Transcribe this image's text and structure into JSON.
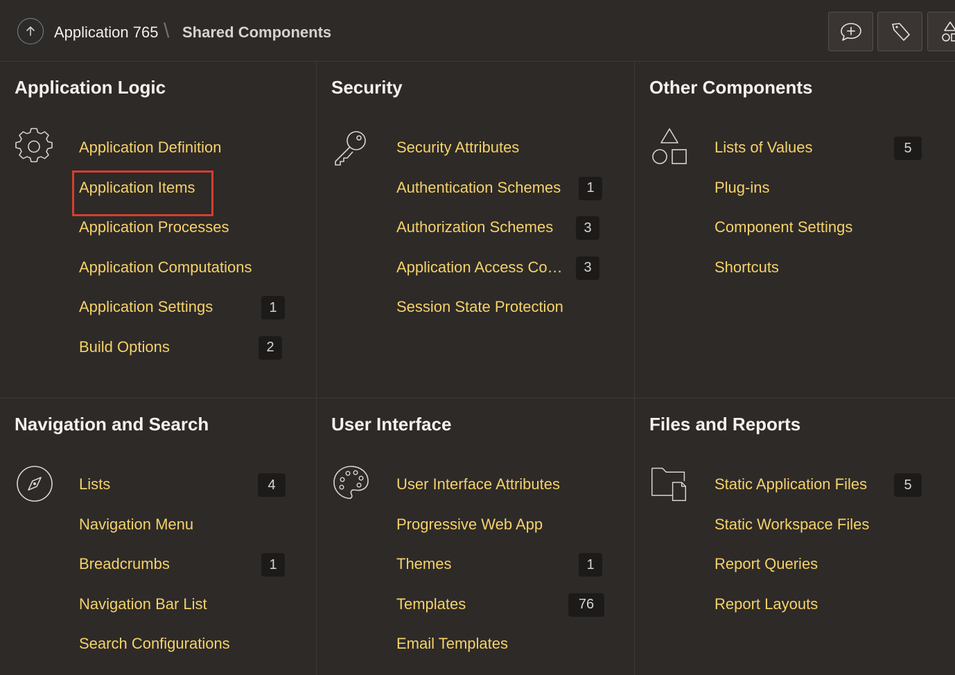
{
  "header": {
    "app_name": "Application 765",
    "separator": "\\",
    "current_page": "Shared Components",
    "tools": [
      "feedback-icon",
      "developer-toolbar-icon",
      "shapes-icon"
    ]
  },
  "accent_colors": {
    "link": "#f4d26a",
    "highlight": "#d2402e",
    "background": "#2e2a28"
  },
  "panels": [
    {
      "title": "Application Logic",
      "icon": "gear-icon",
      "items": [
        {
          "label": "Application Definition",
          "count": null
        },
        {
          "label": "Application Items",
          "count": null,
          "highlighted": true
        },
        {
          "label": "Application Processes",
          "count": null
        },
        {
          "label": "Application Computations",
          "count": null
        },
        {
          "label": "Application Settings",
          "count": "1"
        },
        {
          "label": "Build Options",
          "count": "2"
        }
      ]
    },
    {
      "title": "Security",
      "icon": "key-icon",
      "items": [
        {
          "label": "Security Attributes",
          "count": null
        },
        {
          "label": "Authentication Schemes",
          "count": "1"
        },
        {
          "label": "Authorization Schemes",
          "count": "3"
        },
        {
          "label": "Application Access Co…",
          "count": "3"
        },
        {
          "label": "Session State Protection",
          "count": null
        }
      ]
    },
    {
      "title": "Other Components",
      "icon": "shapes-icon",
      "items": [
        {
          "label": "Lists of Values",
          "count": "5"
        },
        {
          "label": "Plug-ins",
          "count": null
        },
        {
          "label": "Component Settings",
          "count": null
        },
        {
          "label": "Shortcuts",
          "count": null
        }
      ]
    },
    {
      "title": "Navigation and Search",
      "icon": "compass-icon",
      "items": [
        {
          "label": "Lists",
          "count": "4"
        },
        {
          "label": "Navigation Menu",
          "count": null
        },
        {
          "label": "Breadcrumbs",
          "count": "1"
        },
        {
          "label": "Navigation Bar List",
          "count": null
        },
        {
          "label": "Search Configurations",
          "count": null
        }
      ]
    },
    {
      "title": "User Interface",
      "icon": "palette-icon",
      "items": [
        {
          "label": "User Interface Attributes",
          "count": null
        },
        {
          "label": "Progressive Web App",
          "count": null
        },
        {
          "label": "Themes",
          "count": "1"
        },
        {
          "label": "Templates",
          "count": "76"
        },
        {
          "label": "Email Templates",
          "count": null
        }
      ]
    },
    {
      "title": "Files and Reports",
      "icon": "folder-file-icon",
      "items": [
        {
          "label": "Static Application Files",
          "count": "5"
        },
        {
          "label": "Static Workspace Files",
          "count": null
        },
        {
          "label": "Report Queries",
          "count": null
        },
        {
          "label": "Report Layouts",
          "count": null
        }
      ]
    }
  ]
}
